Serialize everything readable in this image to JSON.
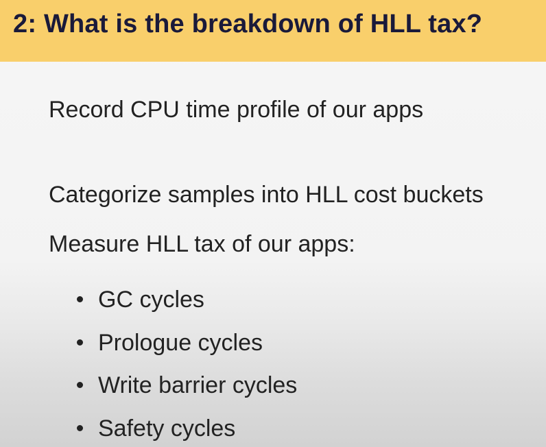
{
  "slide": {
    "title": "2: What is the breakdown of HLL tax?",
    "steps": [
      "Record CPU time profile of our apps",
      "Categorize samples into HLL cost buckets",
      "Measure HLL tax of our apps:"
    ],
    "bullets": [
      "GC cycles",
      "Prologue cycles",
      "Write barrier cycles",
      "Safety cycles"
    ]
  },
  "colors": {
    "title_bar": "#f9cf6b",
    "title_text": "#1a1a3a",
    "body_text": "#222222",
    "background": "#f3f3f3"
  }
}
